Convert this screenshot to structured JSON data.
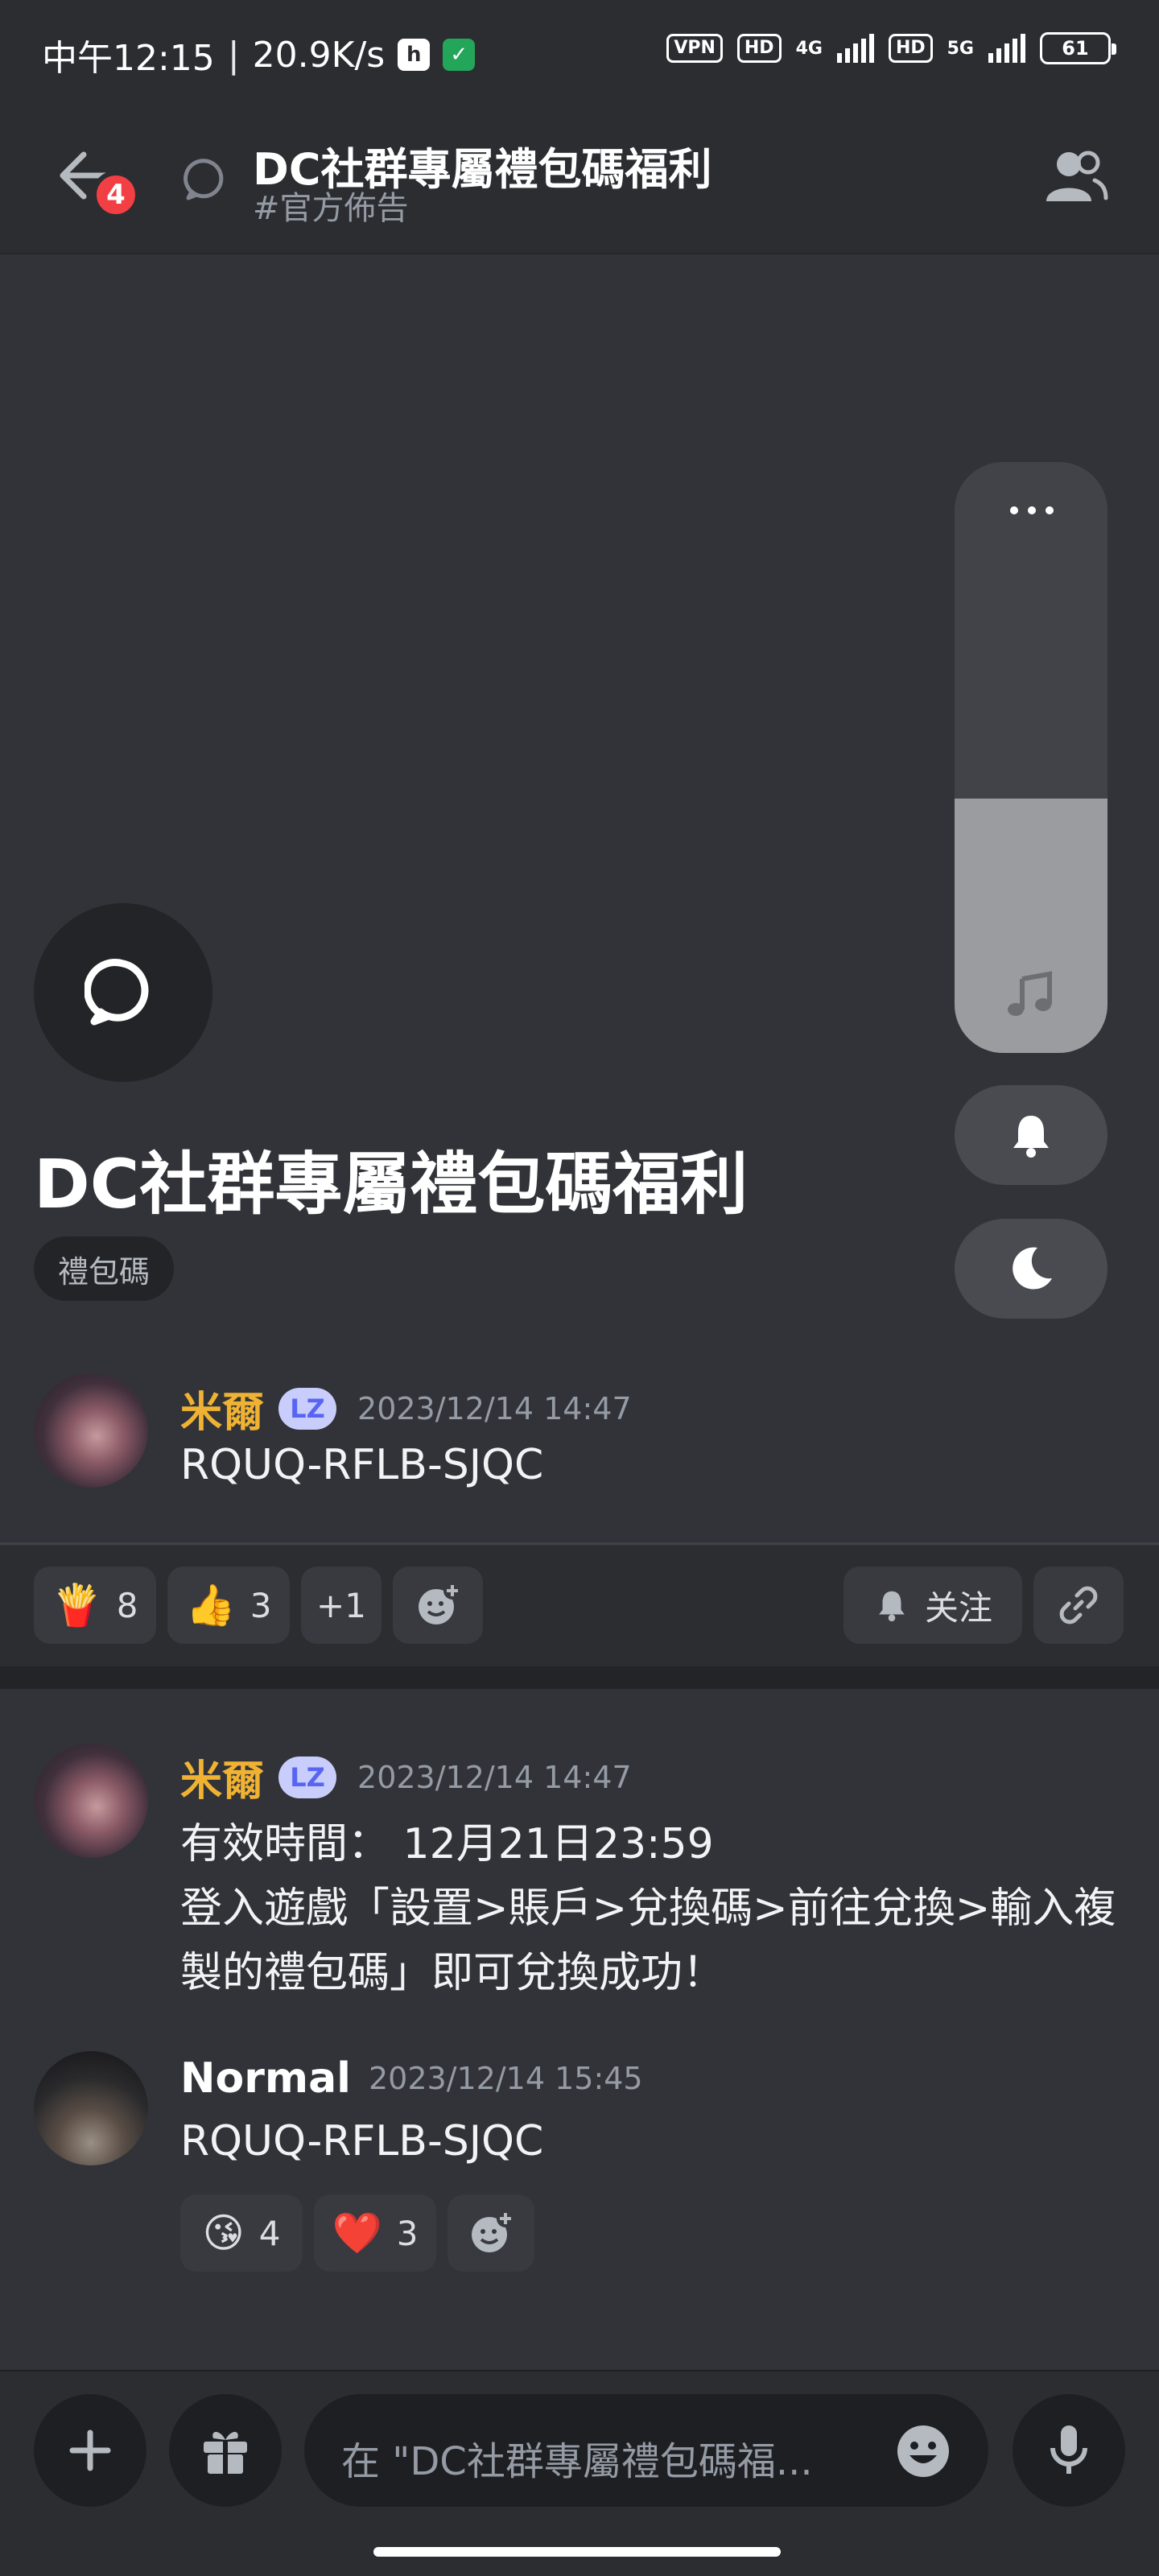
{
  "status_bar": {
    "time": "中午12:15",
    "speed": "20.9K/s",
    "vpn": "VPN",
    "hd1": "HD",
    "net1": "4G",
    "hd2": "HD",
    "net2": "5G",
    "battery": "61"
  },
  "header": {
    "unread_badge": "4",
    "title": "DC社群專屬禮包碼福利",
    "channel": "#官方佈告"
  },
  "post": {
    "title": "DC社群專屬禮包碼福利",
    "tag": "禮包碼"
  },
  "messages": [
    {
      "author": "米爾",
      "role_badge": "LZ",
      "timestamp": "2023/12/14 14:47",
      "lines": [
        "RQUQ-RFLB-SJQC"
      ]
    },
    {
      "author": "米爾",
      "role_badge": "LZ",
      "timestamp": "2023/12/14 14:47",
      "lines": [
        "有效時間： 12月21日23:59",
        "登入遊戲「設置>賬戶>兌換碼>前往兌換>輸入複",
        "製的禮包碼」即可兌換成功！"
      ]
    },
    {
      "author": "Normal",
      "timestamp": "2023/12/14 15:45",
      "lines": [
        "RQUQ-RFLB-SJQC"
      ]
    }
  ],
  "post_reactions": [
    {
      "emoji": "🍟",
      "icon": "fries-icon",
      "count": "8"
    },
    {
      "emoji": "👍",
      "icon": "thumbs-up-icon",
      "count": "3"
    },
    {
      "label": "+1"
    }
  ],
  "post_actions": {
    "follow_label": "关注"
  },
  "msg3_reactions": [
    {
      "emoji": "😘",
      "icon": "kiss-icon",
      "count": "4"
    },
    {
      "emoji": "❤️",
      "icon": "heart-icon",
      "count": "3"
    }
  ],
  "composer": {
    "placeholder": "在 \"DC社群專屬禮包碼福..."
  },
  "volume_panel": {
    "level": 0.43
  },
  "colors": {
    "background": "#313338",
    "header": "#2b2d31",
    "author_gold": "#f0b232",
    "badge_red": "#f23f43",
    "role_badge": "#c9cdfb"
  }
}
